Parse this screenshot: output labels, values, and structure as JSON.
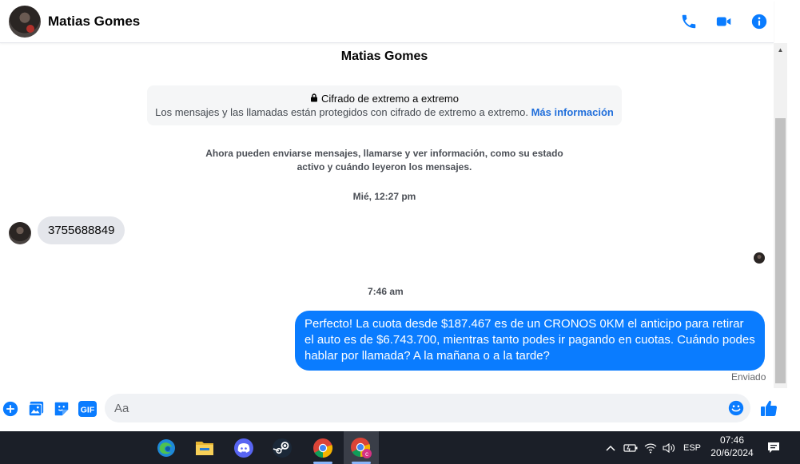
{
  "header": {
    "contact_name": "Matias Gomes",
    "icons": [
      "phone-icon",
      "video-icon",
      "info-icon"
    ],
    "accent": "#0a7cff"
  },
  "chat": {
    "contact_name": "Matias Gomes",
    "encryption": {
      "title": "Cifrado de extremo a extremo",
      "body": "Los mensajes y las llamadas están protegidos con cifrado de extremo a extremo.",
      "link": "Más información"
    },
    "notice_line1": "Ahora pueden enviarse mensajes, llamarse y ver información, como su estado",
    "notice_line2": "activo y cuándo leyeron los mensajes.",
    "timestamp1": "Mié, 12:27 pm",
    "incoming_message": "3755688849",
    "timestamp2": "7:46 am",
    "outgoing_message": "Perfecto! La cuota desde $187.467 es de un CRONOS 0KM el anticipo para retirar el auto es de $6.743.700, mientras tanto podes ir pagando en cuotas. Cuándo podes hablar por llamada? A la mañana o a la tarde?",
    "sent_status": "Enviado"
  },
  "composer": {
    "placeholder": "Aa",
    "gif_label": "GIF"
  },
  "taskbar": {
    "apps": [
      "edge-icon",
      "file-explorer-icon",
      "discord-icon",
      "steam-icon",
      "chrome-icon",
      "chrome-profile-icon"
    ],
    "language": "ESP",
    "time": "07:46",
    "date": "20/6/2024"
  }
}
